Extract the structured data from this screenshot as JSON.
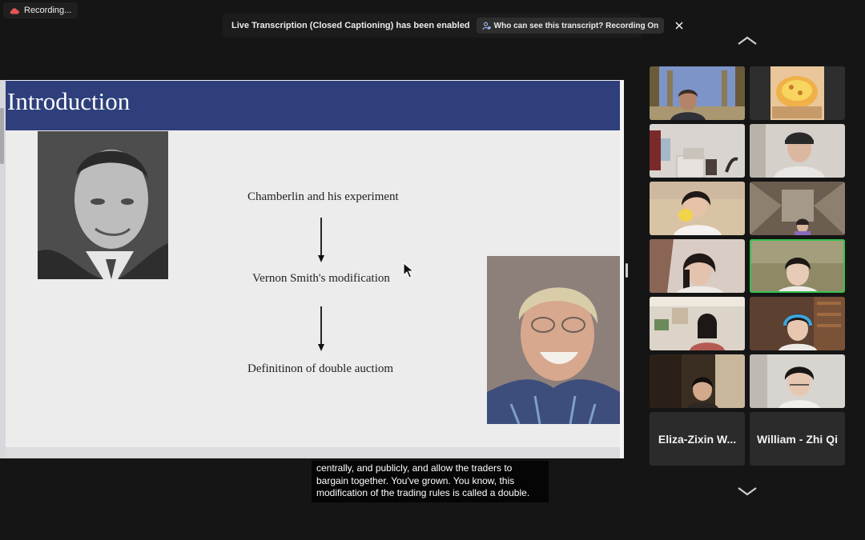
{
  "recording": {
    "label": "Recording..."
  },
  "notification": {
    "message": "Live Transcription (Closed Captioning) has been enabled",
    "who_label": "Who can see this transcript? Recording On"
  },
  "slide": {
    "title": "Introduction",
    "steps": [
      "Chamberlin and his experiment",
      "Vernon Smith's modification",
      "Definitinon of double auctiom"
    ]
  },
  "caption": {
    "lines": [
      "centrally, and publicly, and allow the traders to",
      "bargain together. You've grown. You know, this",
      "modification of the trading rules is called a double."
    ]
  },
  "gallery": {
    "name_tiles": [
      "Eliza-Zixin W...",
      "William - Zhi Qi"
    ]
  },
  "colors": {
    "title_bar": "#2e3f7b",
    "active_speaker": "#36c24f",
    "recording_icon": "#e25555"
  }
}
